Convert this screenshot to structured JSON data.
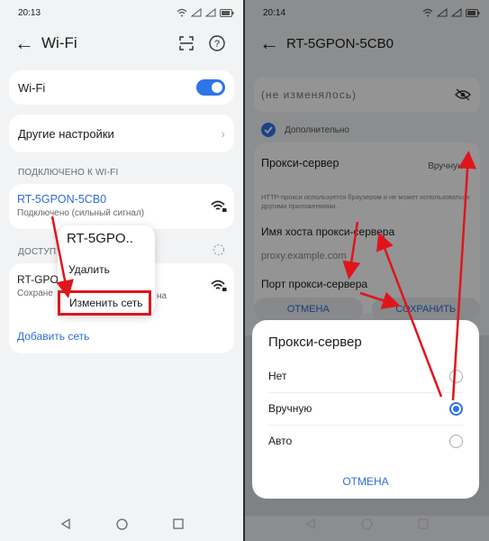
{
  "left": {
    "status": {
      "time": "20:13"
    },
    "title": "Wi-Fi",
    "wifi_toggle_label": "Wi-Fi",
    "other_settings": "Другие настройки",
    "connected_header": "ПОДКЛЮЧЕНО К WI-FI",
    "connected_network": {
      "name": "RT-5GPON-5CB0",
      "status": "Подключено (сильный сигнал)"
    },
    "available_header": "ДОСТУП",
    "available_network": {
      "name": "RT-GPO",
      "status_prefix": "Сохране",
      "status_suffix": "на"
    },
    "add_network": "Добавить сеть",
    "context_menu": {
      "title": "RT-5GPO..",
      "items": [
        "Удалить",
        "Изменить сеть"
      ]
    }
  },
  "right": {
    "status": {
      "time": "20:14"
    },
    "title": "RT-5GPON-5CB0",
    "password_placeholder": "(не изменялось)",
    "advanced_label": "Дополнительно",
    "proxy_label": "Прокси-сервер",
    "proxy_value": "Вручную",
    "proxy_hint": "HTTP-прокси используется браузером и не может использоваться другими приложениями.",
    "host_label": "Имя хоста прокси-сервера",
    "host_placeholder": "proxy.example.com",
    "port_label": "Порт прокси-сервера",
    "cancel_button": "ОТМЕНА",
    "save_button": "СОХРАНИТЬ",
    "dialog": {
      "title": "Прокси-сервер",
      "options": [
        "Нет",
        "Вручную",
        "Авто"
      ],
      "selected": "Вручную",
      "cancel": "ОТМЕНА"
    }
  },
  "colors": {
    "accent": "#2f74e8",
    "annotation": "#e0151c"
  }
}
